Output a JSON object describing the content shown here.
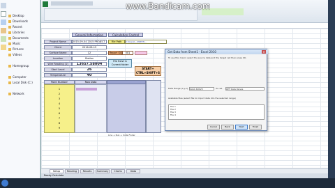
{
  "watermark": "www.Bandicam.com",
  "explorer": {
    "items": [
      "Desktop",
      "Downloads",
      "Recent",
      "Libraries",
      "Documents",
      "Music",
      "Pictures",
      "Videos",
      "Homegroup",
      "Computer",
      "Local Disk (C:)",
      "Network"
    ]
  },
  "sheet": {
    "header_general": "General Information",
    "header_calc": "Calculation Control",
    "fields": [
      {
        "label": "Project Name",
        "value": "2015-09-04 2015 PROJECT NAME"
      },
      {
        "label": "Client",
        "value": "2016-08-19"
      },
      {
        "label": "Surface Name",
        "value": "12"
      },
      {
        "label": "Location",
        "value": "Station"
      },
      {
        "label": "Wire Reading (1)",
        "value": "13657.58004"
      },
      {
        "label": "Start Level",
        "value": "26"
      },
      {
        "label": "Temperature",
        "value": "40"
      }
    ],
    "file_path_label": "File Path",
    "file_path_value": "C:\\Users\\...\\INPUT\\...",
    "report_id_label": "Report ID",
    "report_id_value": "001",
    "file_exist_label": "File Exist in Current folder",
    "start_button": "START+ CTRL+SHIFT+S",
    "table_headers": [
      "Point Number",
      "Raw Data"
    ],
    "rows": [
      "1",
      "2",
      "3",
      "4",
      "5",
      "6",
      "7",
      "8",
      "9",
      "10"
    ],
    "bottom_note": "Line + Run + Code Finder"
  },
  "dialog": {
    "title": "Get Data from Sheet1 - Excel 2010",
    "instructions": "To use this macro select the source data and the target cell then press OK.",
    "range_label": "Data Range (x,y,z)",
    "range_value": "$A$1:$D$25",
    "target_label": "To cell",
    "target_value": "REF Data Range",
    "list_label": "Available files (select file to import data into the selected range)",
    "list_items": [
      "File 1",
      "File 2",
      "File 3",
      "File 4"
    ],
    "buttons": [
      "Cancel",
      "Back",
      "Next",
      "Finish"
    ]
  },
  "sheet_tabs": [
    "Setup",
    "Reading",
    "Results",
    "Summary",
    "Charts",
    "Data"
  ],
  "status": "Ready   Calculate  "
}
